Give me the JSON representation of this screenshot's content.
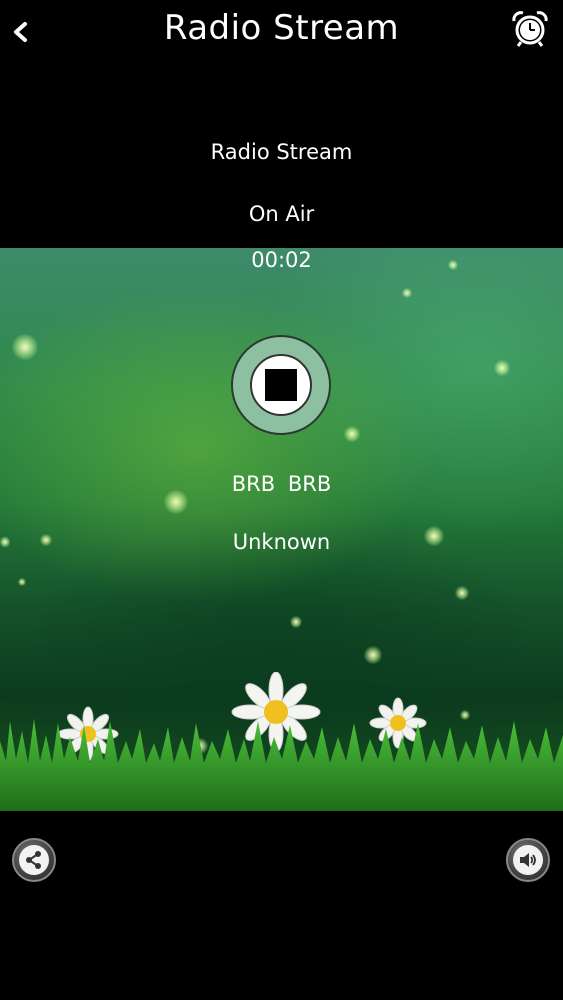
{
  "header": {
    "title": "Radio Stream",
    "back_icon": "chevron-left-icon",
    "alarm_icon": "alarm-clock-icon"
  },
  "player": {
    "station": "Radio Stream",
    "status": "On Air",
    "elapsed": "00:02",
    "control_icon": "stop-icon",
    "artist": "BRB  BRB",
    "album": "Unknown"
  },
  "footer": {
    "share_icon": "share-icon",
    "volume_icon": "volume-icon"
  },
  "colors": {
    "background": "#000000",
    "text": "#ffffff",
    "stop_ring": "#8cc0a0"
  }
}
